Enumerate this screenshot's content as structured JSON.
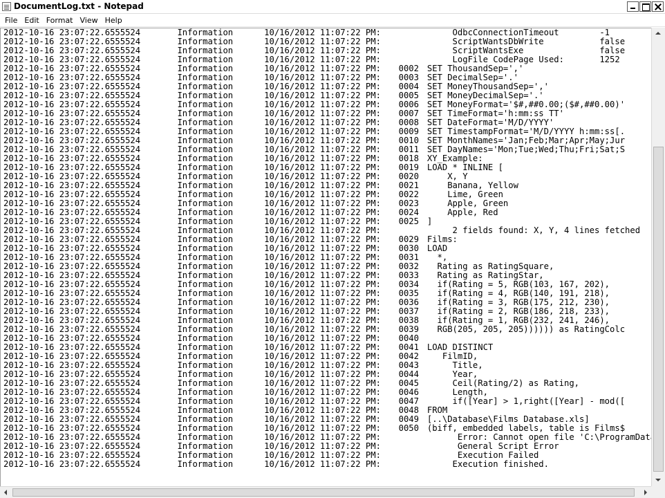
{
  "window": {
    "title": "DocumentLog.txt - Notepad"
  },
  "menu": [
    "File",
    "Edit",
    "Format",
    "View",
    "Help"
  ],
  "lines": [
    {
      "ts": "2012-10-16 23:07:22.6555524",
      "level": "Information",
      "date": "10/16/2012 11:07:22 PM:",
      "num": "",
      "msg": "     OdbcConnectionTimeout        -1"
    },
    {
      "ts": "2012-10-16 23:07:22.6555524",
      "level": "Information",
      "date": "10/16/2012 11:07:22 PM:",
      "num": "",
      "msg": "     ScriptWantsDbWrite           false"
    },
    {
      "ts": "2012-10-16 23:07:22.6555524",
      "level": "Information",
      "date": "10/16/2012 11:07:22 PM:",
      "num": "",
      "msg": "     ScriptWantsExe               false"
    },
    {
      "ts": "2012-10-16 23:07:22.6555524",
      "level": "Information",
      "date": "10/16/2012 11:07:22 PM:",
      "num": "",
      "msg": "     LogFile CodePage Used:       1252"
    },
    {
      "ts": "2012-10-16 23:07:22.6555524",
      "level": "Information",
      "date": "10/16/2012 11:07:22 PM:",
      "num": "0002",
      "msg": "SET ThousandSep=','"
    },
    {
      "ts": "2012-10-16 23:07:22.6555524",
      "level": "Information",
      "date": "10/16/2012 11:07:22 PM:",
      "num": "0003",
      "msg": "SET DecimalSep='.'"
    },
    {
      "ts": "2012-10-16 23:07:22.6555524",
      "level": "Information",
      "date": "10/16/2012 11:07:22 PM:",
      "num": "0004",
      "msg": "SET MoneyThousandSep=','"
    },
    {
      "ts": "2012-10-16 23:07:22.6555524",
      "level": "Information",
      "date": "10/16/2012 11:07:22 PM:",
      "num": "0005",
      "msg": "SET MoneyDecimalSep='.'"
    },
    {
      "ts": "2012-10-16 23:07:22.6555524",
      "level": "Information",
      "date": "10/16/2012 11:07:22 PM:",
      "num": "0006",
      "msg": "SET MoneyFormat='$#,##0.00;($#,##0.00)'"
    },
    {
      "ts": "2012-10-16 23:07:22.6555524",
      "level": "Information",
      "date": "10/16/2012 11:07:22 PM:",
      "num": "0007",
      "msg": "SET TimeFormat='h:mm:ss TT'"
    },
    {
      "ts": "2012-10-16 23:07:22.6555524",
      "level": "Information",
      "date": "10/16/2012 11:07:22 PM:",
      "num": "0008",
      "msg": "SET DateFormat='M/D/YYYY'"
    },
    {
      "ts": "2012-10-16 23:07:22.6555524",
      "level": "Information",
      "date": "10/16/2012 11:07:22 PM:",
      "num": "0009",
      "msg": "SET TimestampFormat='M/D/YYYY h:mm:ss[."
    },
    {
      "ts": "2012-10-16 23:07:22.6555524",
      "level": "Information",
      "date": "10/16/2012 11:07:22 PM:",
      "num": "0010",
      "msg": "SET MonthNames='Jan;Feb;Mar;Apr;May;Jur"
    },
    {
      "ts": "2012-10-16 23:07:22.6555524",
      "level": "Information",
      "date": "10/16/2012 11:07:22 PM:",
      "num": "0011",
      "msg": "SET DayNames='Mon;Tue;Wed;Thu;Fri;Sat;S"
    },
    {
      "ts": "2012-10-16 23:07:22.6555524",
      "level": "Information",
      "date": "10/16/2012 11:07:22 PM:",
      "num": "0018",
      "msg": "XY_Example:"
    },
    {
      "ts": "2012-10-16 23:07:22.6555524",
      "level": "Information",
      "date": "10/16/2012 11:07:22 PM:",
      "num": "0019",
      "msg": "LOAD * INLINE ["
    },
    {
      "ts": "2012-10-16 23:07:22.6555524",
      "level": "Information",
      "date": "10/16/2012 11:07:22 PM:",
      "num": "0020",
      "msg": "    X, Y"
    },
    {
      "ts": "2012-10-16 23:07:22.6555524",
      "level": "Information",
      "date": "10/16/2012 11:07:22 PM:",
      "num": "0021",
      "msg": "    Banana, Yellow"
    },
    {
      "ts": "2012-10-16 23:07:22.6555524",
      "level": "Information",
      "date": "10/16/2012 11:07:22 PM:",
      "num": "0022",
      "msg": "    Lime, Green"
    },
    {
      "ts": "2012-10-16 23:07:22.6555524",
      "level": "Information",
      "date": "10/16/2012 11:07:22 PM:",
      "num": "0023",
      "msg": "    Apple, Green"
    },
    {
      "ts": "2012-10-16 23:07:22.6555524",
      "level": "Information",
      "date": "10/16/2012 11:07:22 PM:",
      "num": "0024",
      "msg": "    Apple, Red"
    },
    {
      "ts": "2012-10-16 23:07:22.6555524",
      "level": "Information",
      "date": "10/16/2012 11:07:22 PM:",
      "num": "0025",
      "msg": "]"
    },
    {
      "ts": "2012-10-16 23:07:22.6555524",
      "level": "Information",
      "date": "10/16/2012 11:07:22 PM:",
      "num": "",
      "msg": "     2 fields found: X, Y, 4 lines fetched"
    },
    {
      "ts": "2012-10-16 23:07:22.6555524",
      "level": "Information",
      "date": "10/16/2012 11:07:22 PM:",
      "num": "0029",
      "msg": "Films:"
    },
    {
      "ts": "2012-10-16 23:07:22.6555524",
      "level": "Information",
      "date": "10/16/2012 11:07:22 PM:",
      "num": "0030",
      "msg": "LOAD"
    },
    {
      "ts": "2012-10-16 23:07:22.6555524",
      "level": "Information",
      "date": "10/16/2012 11:07:22 PM:",
      "num": "0031",
      "msg": "  *,"
    },
    {
      "ts": "2012-10-16 23:07:22.6555524",
      "level": "Information",
      "date": "10/16/2012 11:07:22 PM:",
      "num": "0032",
      "msg": "  Rating as RatingSquare,"
    },
    {
      "ts": "2012-10-16 23:07:22.6555524",
      "level": "Information",
      "date": "10/16/2012 11:07:22 PM:",
      "num": "0033",
      "msg": "  Rating as RatingStar,"
    },
    {
      "ts": "2012-10-16 23:07:22.6555524",
      "level": "Information",
      "date": "10/16/2012 11:07:22 PM:",
      "num": "0034",
      "msg": "  if(Rating = 5, RGB(103, 167, 202),"
    },
    {
      "ts": "2012-10-16 23:07:22.6555524",
      "level": "Information",
      "date": "10/16/2012 11:07:22 PM:",
      "num": "0035",
      "msg": "  if(Rating = 4, RGB(140, 191, 218),"
    },
    {
      "ts": "2012-10-16 23:07:22.6555524",
      "level": "Information",
      "date": "10/16/2012 11:07:22 PM:",
      "num": "0036",
      "msg": "  if(Rating = 3, RGB(175, 212, 230),"
    },
    {
      "ts": "2012-10-16 23:07:22.6555524",
      "level": "Information",
      "date": "10/16/2012 11:07:22 PM:",
      "num": "0037",
      "msg": "  if(Rating = 2, RGB(186, 218, 233),"
    },
    {
      "ts": "2012-10-16 23:07:22.6555524",
      "level": "Information",
      "date": "10/16/2012 11:07:22 PM:",
      "num": "0038",
      "msg": "  if(Rating = 1, RGB(232, 241, 246),"
    },
    {
      "ts": "2012-10-16 23:07:22.6555524",
      "level": "Information",
      "date": "10/16/2012 11:07:22 PM:",
      "num": "0039",
      "msg": "  RGB(205, 205, 205)))))) as RatingColc"
    },
    {
      "ts": "2012-10-16 23:07:22.6555524",
      "level": "Information",
      "date": "10/16/2012 11:07:22 PM:",
      "num": "0040",
      "msg": ""
    },
    {
      "ts": "2012-10-16 23:07:22.6555524",
      "level": "Information",
      "date": "10/16/2012 11:07:22 PM:",
      "num": "0041",
      "msg": "LOAD DISTINCT"
    },
    {
      "ts": "2012-10-16 23:07:22.6555524",
      "level": "Information",
      "date": "10/16/2012 11:07:22 PM:",
      "num": "0042",
      "msg": "   FilmID,"
    },
    {
      "ts": "2012-10-16 23:07:22.6555524",
      "level": "Information",
      "date": "10/16/2012 11:07:22 PM:",
      "num": "0043",
      "msg": "     Title,"
    },
    {
      "ts": "2012-10-16 23:07:22.6555524",
      "level": "Information",
      "date": "10/16/2012 11:07:22 PM:",
      "num": "0044",
      "msg": "     Year,"
    },
    {
      "ts": "2012-10-16 23:07:22.6555524",
      "level": "Information",
      "date": "10/16/2012 11:07:22 PM:",
      "num": "0045",
      "msg": "     Ceil(Rating/2) as Rating,"
    },
    {
      "ts": "2012-10-16 23:07:22.6555524",
      "level": "Information",
      "date": "10/16/2012 11:07:22 PM:",
      "num": "0046",
      "msg": "     Length,"
    },
    {
      "ts": "2012-10-16 23:07:22.6555524",
      "level": "Information",
      "date": "10/16/2012 11:07:22 PM:",
      "num": "0047",
      "msg": "     if([Year] > 1,right([Year] - mod(["
    },
    {
      "ts": "2012-10-16 23:07:22.6555524",
      "level": "Information",
      "date": "10/16/2012 11:07:22 PM:",
      "num": "0048",
      "msg": "FROM"
    },
    {
      "ts": "2012-10-16 23:07:22.6555524",
      "level": "Information",
      "date": "10/16/2012 11:07:22 PM:",
      "num": "0049",
      "msg": "[..\\Database\\Films Database.xls]"
    },
    {
      "ts": "2012-10-16 23:07:22.6555524",
      "level": "Information",
      "date": "10/16/2012 11:07:22 PM:",
      "num": "0050",
      "msg": "(biff, embedded labels, table is Films$"
    },
    {
      "ts": "2012-10-16 23:07:22.6555524",
      "level": "Information",
      "date": "10/16/2012 11:07:22 PM:",
      "num": "",
      "msg": "      Error: Cannot open file 'C:\\ProgramData"
    },
    {
      "ts": "2012-10-16 23:07:22.6555524",
      "level": "Information",
      "date": "10/16/2012 11:07:22 PM:",
      "num": "",
      "msg": "      General Script Error"
    },
    {
      "ts": "2012-10-16 23:07:22.6555524",
      "level": "Information",
      "date": "10/16/2012 11:07:22 PM:",
      "num": "",
      "msg": "      Execution Failed"
    },
    {
      "ts": "2012-10-16 23:07:22.6555524",
      "level": "Information",
      "date": "10/16/2012 11:07:22 PM:",
      "num": "",
      "msg": "     Execution finished."
    }
  ]
}
